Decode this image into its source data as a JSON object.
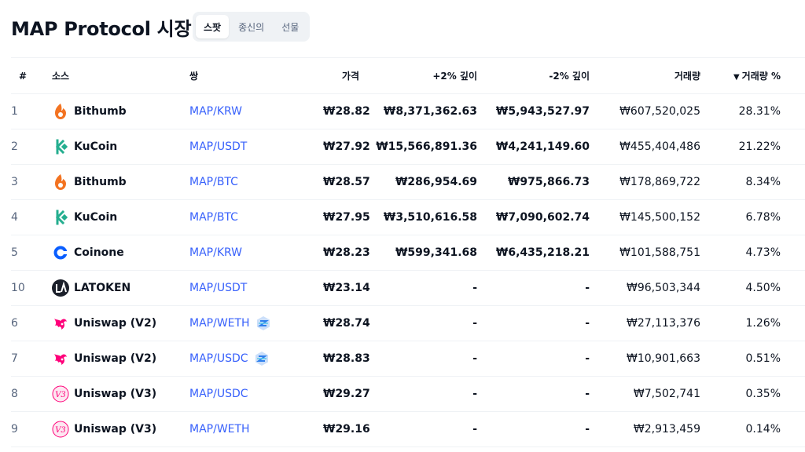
{
  "page": {
    "title": "MAP Protocol 시장"
  },
  "tabs": [
    {
      "label": "스팟",
      "active": true
    },
    {
      "label": "종신의",
      "active": false
    },
    {
      "label": "선물",
      "active": false
    }
  ],
  "table": {
    "headers": {
      "num": "#",
      "source": "소스",
      "pair": "쌍",
      "price": "가격",
      "depth_plus": "+2% 깊이",
      "depth_minus": "-2% 깊이",
      "volume": "거래량",
      "volume_pct": "거래량 %"
    },
    "rows": [
      {
        "num": "1",
        "source": "Bithumb",
        "logo": "bithumb-logo",
        "pair": "MAP/KRW",
        "dex_badge": false,
        "price": "₩28.82",
        "depth_plus": "₩8,371,362.63",
        "depth_minus": "₩5,943,527.97",
        "volume": "₩607,520,025",
        "volume_pct": "28.31%"
      },
      {
        "num": "2",
        "source": "KuCoin",
        "logo": "kucoin-logo",
        "pair": "MAP/USDT",
        "dex_badge": false,
        "price": "₩27.92",
        "depth_plus": "₩15,566,891.36",
        "depth_minus": "₩4,241,149.60",
        "volume": "₩455,404,486",
        "volume_pct": "21.22%"
      },
      {
        "num": "3",
        "source": "Bithumb",
        "logo": "bithumb-logo",
        "pair": "MAP/BTC",
        "dex_badge": false,
        "price": "₩28.57",
        "depth_plus": "₩286,954.69",
        "depth_minus": "₩975,866.73",
        "volume": "₩178,869,722",
        "volume_pct": "8.34%"
      },
      {
        "num": "4",
        "source": "KuCoin",
        "logo": "kucoin-logo",
        "pair": "MAP/BTC",
        "dex_badge": false,
        "price": "₩27.95",
        "depth_plus": "₩3,510,616.58",
        "depth_minus": "₩7,090,602.74",
        "volume": "₩145,500,152",
        "volume_pct": "6.78%"
      },
      {
        "num": "5",
        "source": "Coinone",
        "logo": "coinone-logo",
        "pair": "MAP/KRW",
        "dex_badge": false,
        "price": "₩28.23",
        "depth_plus": "₩599,341.68",
        "depth_minus": "₩6,435,218.21",
        "volume": "₩101,588,751",
        "volume_pct": "4.73%"
      },
      {
        "num": "10",
        "source": "LATOKEN",
        "logo": "latoken-logo",
        "pair": "MAP/USDT",
        "dex_badge": false,
        "price": "₩23.14",
        "depth_plus": "-",
        "depth_minus": "-",
        "volume": "₩96,503,344",
        "volume_pct": "4.50%"
      },
      {
        "num": "6",
        "source": "Uniswap (V2)",
        "logo": "uniswap-logo",
        "pair": "MAP/WETH",
        "dex_badge": true,
        "price": "₩28.74",
        "depth_plus": "-",
        "depth_minus": "-",
        "volume": "₩27,113,376",
        "volume_pct": "1.26%"
      },
      {
        "num": "7",
        "source": "Uniswap (V2)",
        "logo": "uniswap-logo",
        "pair": "MAP/USDC",
        "dex_badge": true,
        "price": "₩28.83",
        "depth_plus": "-",
        "depth_minus": "-",
        "volume": "₩10,901,663",
        "volume_pct": "0.51%"
      },
      {
        "num": "8",
        "source": "Uniswap (V3)",
        "logo": "uniswap-v3-logo",
        "pair": "MAP/USDC",
        "dex_badge": false,
        "price": "₩29.27",
        "depth_plus": "-",
        "depth_minus": "-",
        "volume": "₩7,502,741",
        "volume_pct": "0.35%"
      },
      {
        "num": "9",
        "source": "Uniswap (V3)",
        "logo": "uniswap-v3-logo",
        "pair": "MAP/WETH",
        "dex_badge": false,
        "price": "₩29.16",
        "depth_plus": "-",
        "depth_minus": "-",
        "volume": "₩2,913,459",
        "volume_pct": "0.14%"
      }
    ]
  },
  "colors": {
    "link": "#3861fb",
    "muted": "#58667e",
    "text": "#0d1421",
    "bithumb": "#f37321",
    "kucoin": "#24ae8f",
    "coinone": "#0a5eff",
    "uniswap": "#ff007a",
    "latoken": "#1b1f2a"
  }
}
